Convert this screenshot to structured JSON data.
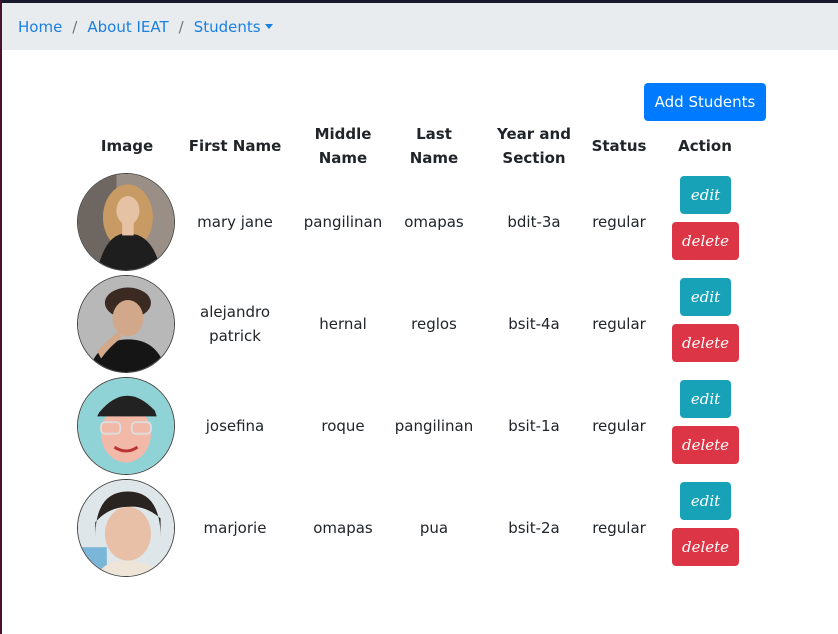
{
  "breadcrumb": {
    "home": "Home",
    "about": "About IEAT",
    "students": "Students"
  },
  "add_button": "Add Students",
  "table": {
    "headers": {
      "image": "Image",
      "first_name": "First Name",
      "middle_name": "Middle Name",
      "last_name": "Last Name",
      "year_section": "Year and Section",
      "status": "Status",
      "action": "Action"
    },
    "rows": [
      {
        "first_name": "mary jane",
        "middle_name": "pangilinan",
        "last_name": "omapas",
        "year_section": "bdit-3a",
        "status": "regular",
        "edit": "edit",
        "delete": "delete"
      },
      {
        "first_name": "alejandro patrick",
        "middle_name": "hernal",
        "last_name": "reglos",
        "year_section": "bsit-4a",
        "status": "regular",
        "edit": "edit",
        "delete": "delete"
      },
      {
        "first_name": "josefina",
        "middle_name": "roque",
        "last_name": "pangilinan",
        "year_section": "bsit-1a",
        "status": "regular",
        "edit": "edit",
        "delete": "delete"
      },
      {
        "first_name": "marjorie",
        "middle_name": "omapas",
        "last_name": "pua",
        "year_section": "bsit-2a",
        "status": "regular",
        "edit": "edit",
        "delete": "delete"
      }
    ]
  }
}
